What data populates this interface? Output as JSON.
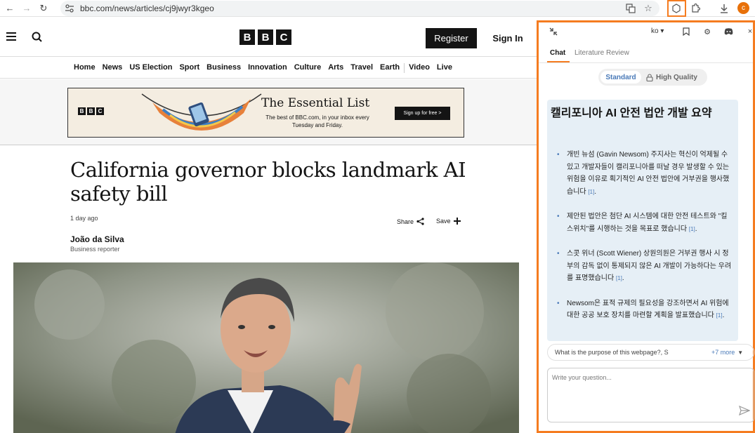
{
  "browser": {
    "url": "bbc.com/news/articles/cj9jwyr3kgeo",
    "avatar_letter": "c"
  },
  "bbc": {
    "register_label": "Register",
    "signin_label": "Sign In",
    "logo_letters": [
      "B",
      "B",
      "C"
    ],
    "nav": [
      "Home",
      "News",
      "US Election",
      "Sport",
      "Business",
      "Innovation",
      "Culture",
      "Arts",
      "Travel",
      "Earth",
      "Video",
      "Live"
    ],
    "banner": {
      "title": "The Essential List",
      "text": "The best of BBC.com, in your inbox every Tuesday and Friday.",
      "cta": "Sign up for free >"
    },
    "article": {
      "headline": "California governor blocks landmark AI safety bill",
      "date": "1 day ago",
      "share_label": "Share",
      "save_label": "Save",
      "author": "João da Silva",
      "author_role": "Business reporter"
    }
  },
  "sidebar": {
    "language": "ko",
    "tabs": [
      "Chat",
      "Literature Review"
    ],
    "mode_standard": "Standard",
    "mode_hq": "High Quality",
    "answer": {
      "title": "캘리포니아 AI 안전 법안 개발 요약",
      "bullets": [
        "개빈 뉴섬 (Gavin Newsom) 주지사는 혁신이 억제될 수 있고 개발자들이 캘리포니아를 떠날 경우 발생할 수 있는 위험을 이유로 획기적인 AI 안전 법안에 거부권을 행사했습니다",
        "제안된 법안은 첨단 AI 시스템에 대한 안전 테스트와 \"킬 스위치\"를 시행하는 것을 목표로 했습니다",
        "스콧 위너 (Scott Wiener) 상원의원은 거부권 행사 시 정부의 감독 없이 통제되지 않은 AI 개발이 가능하다는 우려를 표명했습니다",
        "Newsom은 표적 규제의 필요성을 강조하면서 AI 위험에 대한 공공 보호 장치를 마련할 계획을 발표했습니다"
      ],
      "cite": "[1]"
    },
    "suggestion": "What is the purpose of this webpage?, S",
    "more_label": "+7 more",
    "input_placeholder": "Write your question..."
  }
}
